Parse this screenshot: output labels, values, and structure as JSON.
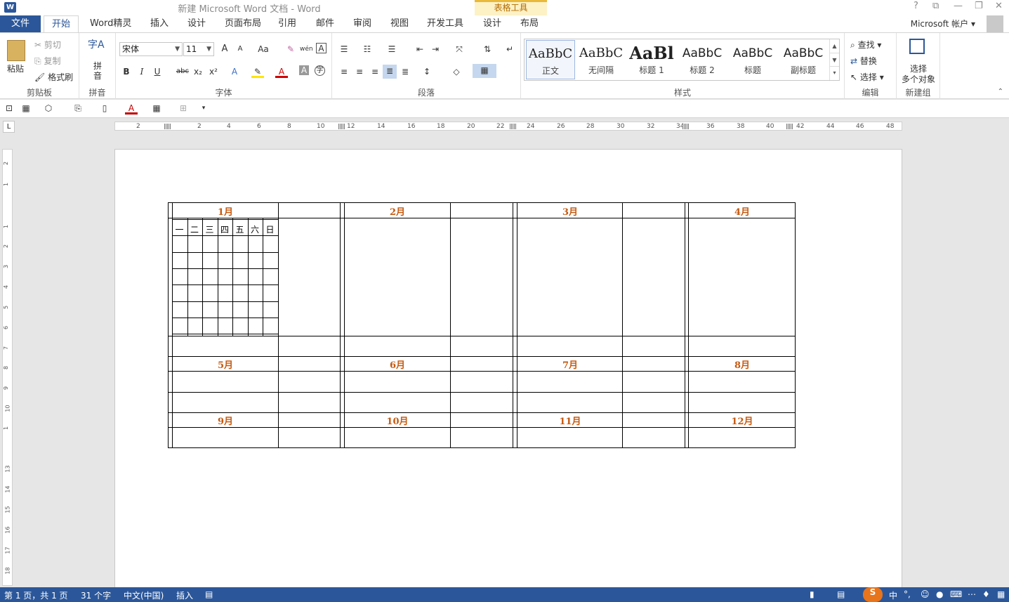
{
  "titlebar": {
    "logo": "W",
    "doc_title": "新建 Microsoft Word 文档 - Word",
    "context_group": "表格工具",
    "help": "?",
    "restore_ribbon": "⧉",
    "minimize": "—",
    "maximize": "❐",
    "close": "✕"
  },
  "tabs": {
    "file": "文件",
    "items": [
      "开始",
      "Word精灵",
      "插入",
      "设计",
      "页面布局",
      "引用",
      "邮件",
      "审阅",
      "视图",
      "开发工具",
      "设计",
      "布局"
    ]
  },
  "account": {
    "label": "Microsoft 帐户"
  },
  "ribbon": {
    "clipboard": {
      "paste": "粘贴",
      "cut": "剪切",
      "copy": "复制",
      "format_painter": "格式刷",
      "label": "剪贴板"
    },
    "pinyin": {
      "button": "拼音",
      "icon_text": "字A",
      "label": "拼音"
    },
    "font": {
      "name": "宋体",
      "size": "11",
      "bold": "B",
      "italic": "I",
      "underline": "U",
      "strike": "abc",
      "sub": "x₂",
      "sup": "x²",
      "grow": "A",
      "shrink": "A",
      "case": "Aa",
      "label": "字体"
    },
    "paragraph": {
      "label": "段落"
    },
    "styles": {
      "items": [
        {
          "sample": "AaBbC",
          "name": "正文"
        },
        {
          "sample": "AaBbC",
          "name": "无间隔"
        },
        {
          "sample": "AaBl",
          "name": "标题 1"
        },
        {
          "sample": "AaBbC",
          "name": "标题 2"
        },
        {
          "sample": "AaBbC",
          "name": "标题"
        },
        {
          "sample": "AaBbC",
          "name": "副标题"
        }
      ],
      "label": "样式"
    },
    "editing": {
      "find": "查找",
      "replace": "替换",
      "select": "选择",
      "label": "编辑"
    },
    "newgroup": {
      "button_line1": "选择",
      "button_line2": "多个对象",
      "label": "新建组"
    }
  },
  "ruler": {
    "tab_selector": "L",
    "h_numbers": [
      "2",
      "2",
      "4",
      "6",
      "8",
      "10",
      "12",
      "14",
      "16",
      "18",
      "20",
      "22",
      "24",
      "26",
      "28",
      "30",
      "32",
      "34",
      "36",
      "38",
      "40",
      "42",
      "44",
      "46",
      "48"
    ],
    "v_numbers": [
      "2",
      "1",
      "1",
      "2",
      "3",
      "4",
      "5",
      "6",
      "7",
      "8",
      "9",
      "10",
      "1",
      "13",
      "14",
      "15",
      "16",
      "17",
      "18"
    ]
  },
  "calendar": {
    "months": [
      "1月",
      "2月",
      "3月",
      "4月",
      "5月",
      "6月",
      "7月",
      "8月",
      "9月",
      "10月",
      "11月",
      "12月"
    ],
    "weekdays": [
      "一",
      "二",
      "三",
      "四",
      "五",
      "六",
      "日"
    ]
  },
  "status": {
    "page": "第 1 页，共 1 页",
    "words": "31 个字",
    "language": "中文(中国)",
    "mode": "插入",
    "ime": "中",
    "punct": "°,"
  },
  "colors": {
    "accent": "#2b579a",
    "month": "#c55a11",
    "context": "#fdf1c6"
  }
}
